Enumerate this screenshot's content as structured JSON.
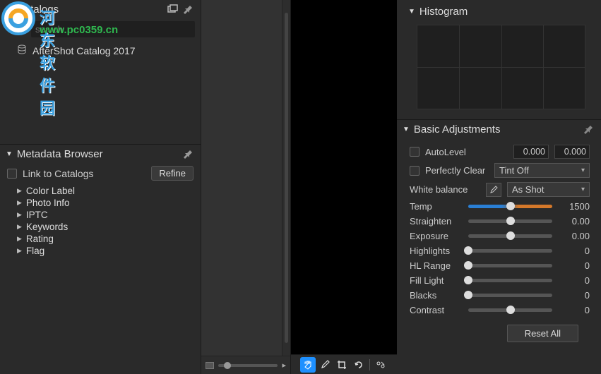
{
  "watermark": {
    "brand": "河东软件园",
    "url": "www.pc0359.cn"
  },
  "left": {
    "catalogs": {
      "title": "Catalogs",
      "search_placeholder": "search",
      "catalog_name": "AfterShot Catalog 2017"
    },
    "metadata": {
      "title": "Metadata Browser",
      "link_label": "Link to Catalogs",
      "refine_label": "Refine",
      "tree": [
        {
          "label": "Color Label"
        },
        {
          "label": "Photo Info"
        },
        {
          "label": "IPTC"
        },
        {
          "label": "Keywords"
        },
        {
          "label": "Rating"
        },
        {
          "label": "Flag"
        }
      ]
    }
  },
  "center_tools": {
    "pan": "✋",
    "eyedrop": "✎",
    "crop": "▣",
    "rotate": "⟳",
    "settings": "⚙"
  },
  "right": {
    "histogram_title": "Histogram",
    "basic_title": "Basic Adjustments",
    "autolevel_label": "AutoLevel",
    "autolevel_a": "0.000",
    "autolevel_b": "0.000",
    "perfclear_label": "Perfectly Clear",
    "perfclear_value": "Tint Off",
    "wb_label": "White balance",
    "wb_value": "As Shot",
    "sliders": {
      "temp": {
        "label": "Temp",
        "value": "1500",
        "pos": 50
      },
      "straighten": {
        "label": "Straighten",
        "value": "0.00",
        "pos": 50
      },
      "exposure": {
        "label": "Exposure",
        "value": "0.00",
        "pos": 50
      },
      "highlights": {
        "label": "Highlights",
        "value": "0",
        "pos": 0
      },
      "hlrange": {
        "label": "HL Range",
        "value": "0",
        "pos": 0
      },
      "filllight": {
        "label": "Fill Light",
        "value": "0",
        "pos": 0
      },
      "blacks": {
        "label": "Blacks",
        "value": "0",
        "pos": 0
      },
      "contrast": {
        "label": "Contrast",
        "value": "0",
        "pos": 50
      }
    },
    "reset_label": "Reset All"
  }
}
